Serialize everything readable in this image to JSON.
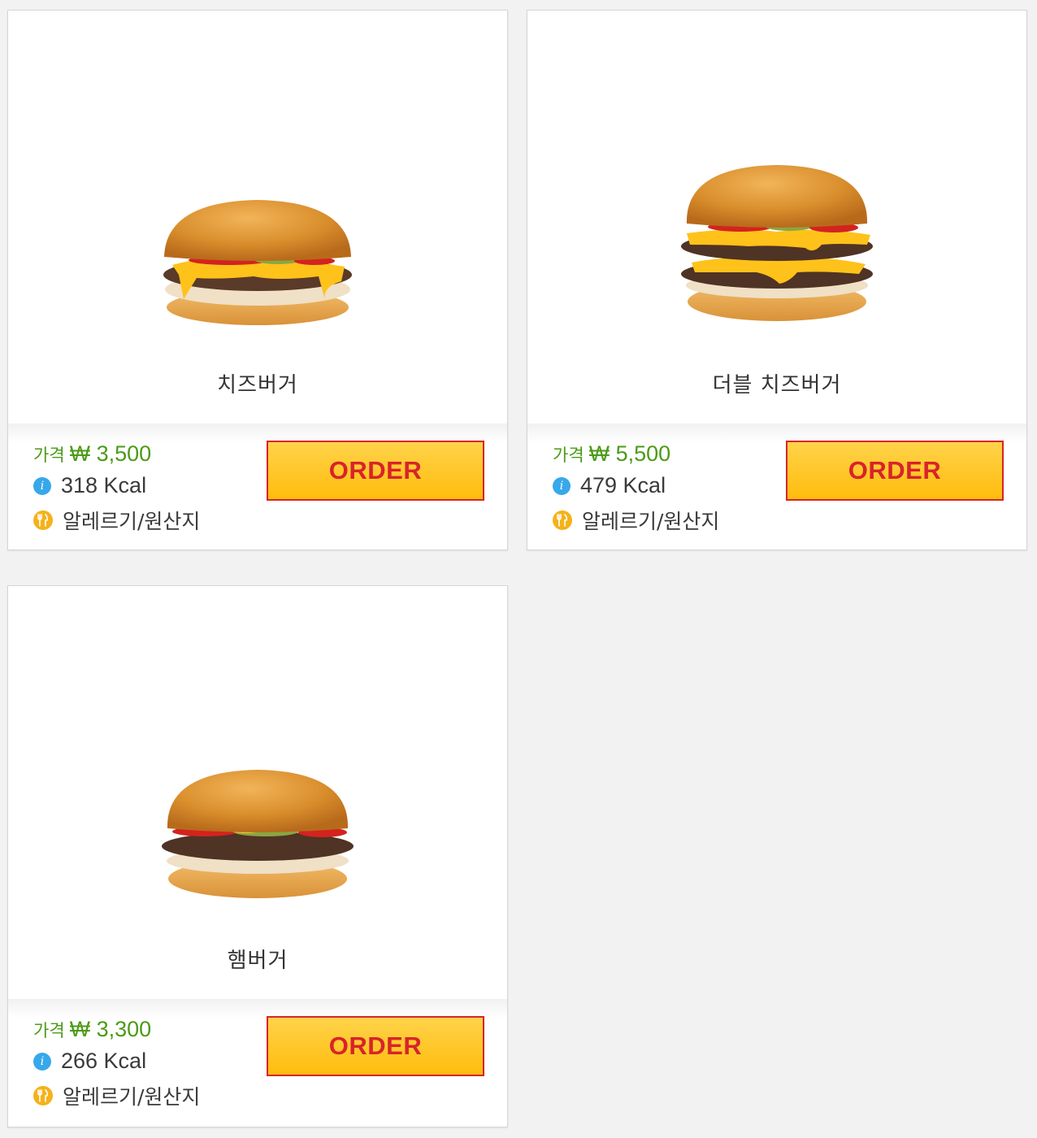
{
  "products": [
    {
      "name": "치즈버거",
      "price_label": "가격",
      "price": "₩ 3,500",
      "kcal": "318 Kcal",
      "allergy_link": "알레르기/원산지",
      "order_label": "ORDER",
      "image": "cheeseburger"
    },
    {
      "name": "더블 치즈버거",
      "price_label": "가격",
      "price": "₩ 5,500",
      "kcal": "479 Kcal",
      "allergy_link": "알레르기/원산지",
      "order_label": "ORDER",
      "image": "double-cheeseburger"
    },
    {
      "name": "햄버거",
      "price_label": "가격",
      "price": "₩ 3,300",
      "kcal": "266 Kcal",
      "allergy_link": "알레르기/원산지",
      "order_label": "ORDER",
      "image": "hamburger"
    }
  ],
  "colors": {
    "price_green": "#4c9a17",
    "order_red": "#d8232a",
    "order_yellow": "#ffbc0d",
    "info_blue": "#37a8ea",
    "allergy_yellow": "#f4b21b",
    "page_background": "#f2f2f2"
  },
  "icons": {
    "kcal": "info-icon",
    "allergy": "allergy-icon"
  }
}
